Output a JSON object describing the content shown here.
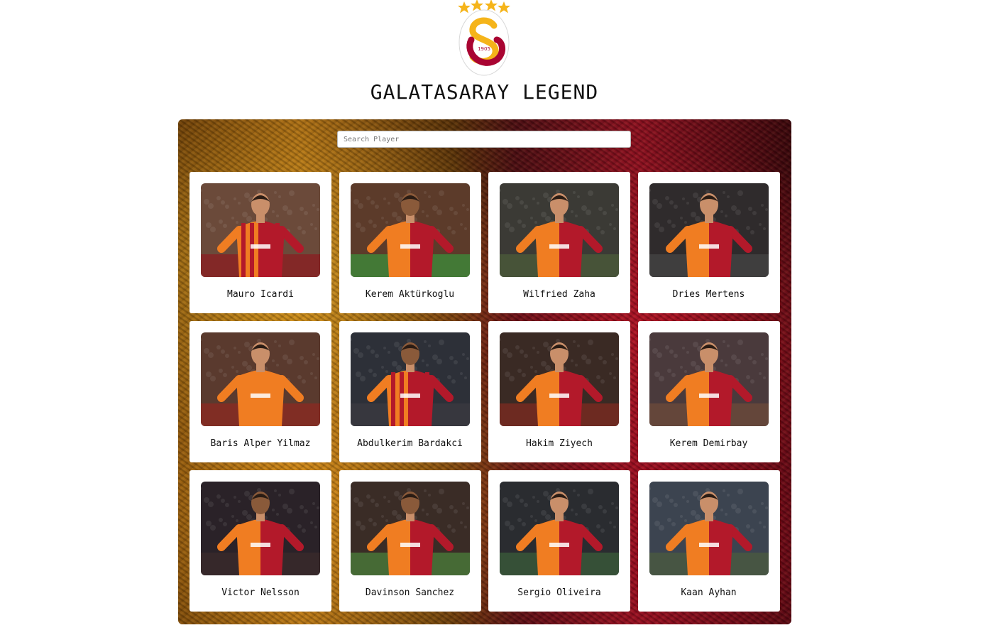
{
  "header": {
    "title": "GALATASARAY LEGEND",
    "logo_year": "1905",
    "logo_stars": 4,
    "brand_colors": {
      "yellow": "#f5b41a",
      "red": "#a90432"
    }
  },
  "search": {
    "placeholder": "Search Player",
    "value": ""
  },
  "players": [
    {
      "name": "Mauro Icardi",
      "kit": "stripes",
      "bg": "#6b4a3a",
      "pitch": "#8a1f23"
    },
    {
      "name": "Kerem Aktürkoglu",
      "kit": "half",
      "bg": "#5c3b2a",
      "pitch": "#3d8a3a"
    },
    {
      "name": "Wilfried Zaha",
      "kit": "half",
      "bg": "#3b3a35",
      "pitch": "#4b5a3a"
    },
    {
      "name": "Dries Mertens",
      "kit": "half",
      "bg": "#2f2b2c",
      "pitch": "#444"
    },
    {
      "name": "Baris Alper Yilmaz",
      "kit": "orange",
      "bg": "#5a3a2e",
      "pitch": "#8a2a22"
    },
    {
      "name": "Abdulkerim Bardakci",
      "kit": "stripes",
      "bg": "#2d3038",
      "pitch": "#3a3a40"
    },
    {
      "name": "Hakim Ziyech",
      "kit": "half",
      "bg": "#3a2a24",
      "pitch": "#7a2a20"
    },
    {
      "name": "Kerem Demirbay",
      "kit": "half",
      "bg": "#4a3a3c",
      "pitch": "#6a4a3a"
    },
    {
      "name": "Victor Nelsson",
      "kit": "half",
      "bg": "#2a2228",
      "pitch": "#3a2a2a"
    },
    {
      "name": "Davinson Sanchez",
      "kit": "half",
      "bg": "#3a2c26",
      "pitch": "#4a7a3a"
    },
    {
      "name": "Sergio Oliveira",
      "kit": "half",
      "bg": "#2a2c30",
      "pitch": "#3a5a3a"
    },
    {
      "name": "Kaan Ayhan",
      "kit": "half",
      "bg": "#3c4450",
      "pitch": "#4a5a40"
    }
  ]
}
